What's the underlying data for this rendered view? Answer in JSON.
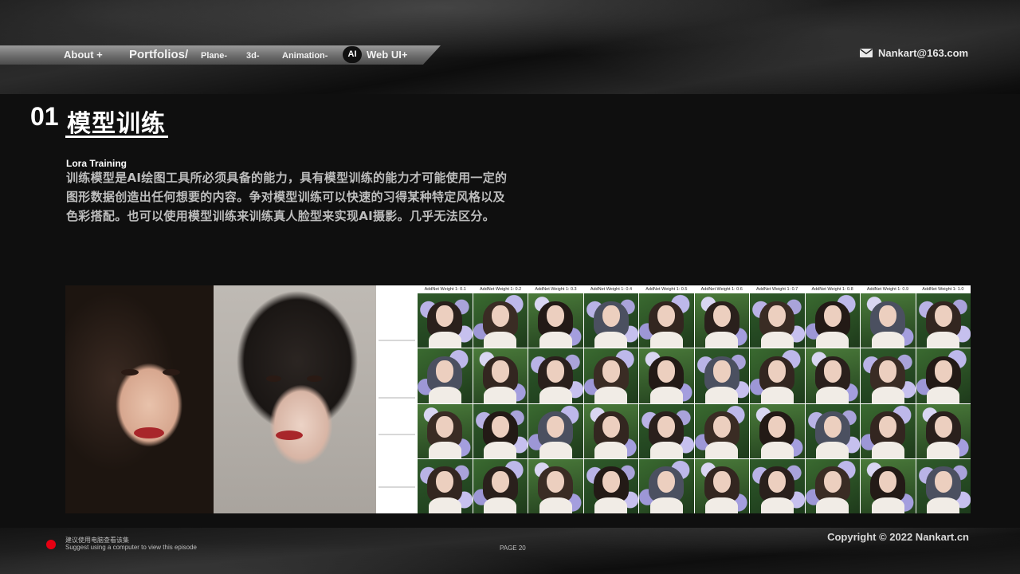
{
  "nav": {
    "about": "About +",
    "portfolios": "Portfolios/",
    "plane": "Plane-",
    "three_d": "3d-",
    "animation": "Animation-",
    "ai_badge": "AI",
    "web_ui": "Web UI+"
  },
  "contact": {
    "email": "Nankart@163.com",
    "icon": "mail-icon"
  },
  "section": {
    "number": "01",
    "title": "模型训练",
    "subtitle": "Lora Training",
    "description": "训练模型是AI绘图工具所必须具备的能力，具有模型训练的能力才可能使用一定的图形数据创造出任何想要的内容。争对模型训练可以快速的习得某种特定风格以及色彩搭配。也可以使用模型训练来训练真人脸型来实现AI摄影。几乎无法区分。"
  },
  "grid": {
    "column_headers": [
      "AddNet Weight 1: 0.1",
      "AddNet Weight 1: 0.2",
      "AddNet Weight 1: 0.3",
      "AddNet Weight 1: 0.4",
      "AddNet Weight 1: 0.5",
      "AddNet Weight 1: 0.6",
      "AddNet Weight 1: 0.7",
      "AddNet Weight 1: 0.8",
      "AddNet Weight 1: 0.9",
      "AddNet Weight 1: 1.0"
    ],
    "rows": 4
  },
  "footer": {
    "hint_cn": "建议使用电脑查看该集",
    "hint_en": "Suggest using a computer to view this episode",
    "page": "PAGE  20",
    "copyright": "Copyright © 2022 Nankart.cn"
  },
  "colors": {
    "accent_red": "#e60012",
    "nav_bar": "#8a8a8a",
    "background": "#0f0f0f"
  }
}
